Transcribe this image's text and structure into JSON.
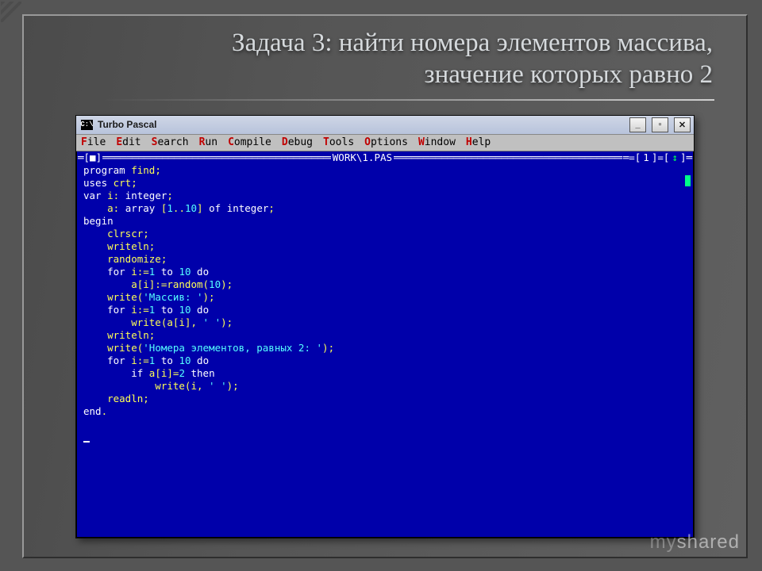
{
  "slide": {
    "title": "Задача 3: найти номера элементов массива, значение которых равно 2"
  },
  "window": {
    "icon_text": "C:\\",
    "title": "Turbo Pascal",
    "buttons": {
      "min": "_",
      "max": "▫",
      "close": "✕"
    }
  },
  "menubar": {
    "items": [
      {
        "hot": "F",
        "rest": "ile"
      },
      {
        "hot": "E",
        "rest": "dit"
      },
      {
        "hot": "S",
        "rest": "earch"
      },
      {
        "hot": "R",
        "rest": "un"
      },
      {
        "hot": "C",
        "rest": "ompile"
      },
      {
        "hot": "D",
        "rest": "ebug"
      },
      {
        "hot": "T",
        "rest": "ools"
      },
      {
        "hot": "O",
        "rest": "ptions"
      },
      {
        "hot": "W",
        "rest": "indow"
      },
      {
        "hot": "H",
        "rest": "elp"
      }
    ]
  },
  "editor": {
    "frame": {
      "filename": " WORK\\1.PAS ",
      "index": "1",
      "brackets_left": "═[■]",
      "brackets_right_num": "═=[",
      "arrow": "↕",
      "brackets_end": "]═"
    },
    "code": {
      "l01a": "program",
      "l01b": " find",
      "l01c": ";",
      "l02a": "uses",
      "l02b": " crt",
      "l02c": ";",
      "l03a": "var",
      "l03b": " i: ",
      "l03c": "integer",
      "l03d": ";",
      "l04a": "    a: ",
      "l04b": "array",
      "l04c": " [",
      "l04d": "1",
      "l04e": "..",
      "l04f": "10",
      "l04g": "] ",
      "l04h": "of",
      "l04i": " ",
      "l04j": "integer",
      "l04k": ";",
      "l05a": "begin",
      "l06a": "    clrscr;",
      "l07a": "    writeln;",
      "l08a": "    randomize;",
      "l09a": "    ",
      "l09b": "for",
      "l09c": " i:=",
      "l09d": "1",
      "l09e": " ",
      "l09f": "to",
      "l09g": " ",
      "l09h": "10",
      "l09i": " ",
      "l09j": "do",
      "l10a": "        a[i]:=random(",
      "l10b": "10",
      "l10c": ");",
      "l11a": "    write(",
      "l11b": "'Массив: '",
      "l11c": ");",
      "l12a": "    ",
      "l12b": "for",
      "l12c": " i:=",
      "l12d": "1",
      "l12e": " ",
      "l12f": "to",
      "l12g": " ",
      "l12h": "10",
      "l12i": " ",
      "l12j": "do",
      "l13a": "        write(a[i], ",
      "l13b": "' '",
      "l13c": ");",
      "l14a": "    writeln;",
      "l15a": "    write(",
      "l15b": "'Номера элементов, равных 2: '",
      "l15c": ");",
      "l16a": "    ",
      "l16b": "for",
      "l16c": " i:=",
      "l16d": "1",
      "l16e": " ",
      "l16f": "to",
      "l16g": " ",
      "l16h": "10",
      "l16i": " ",
      "l16j": "do",
      "l17a": "        ",
      "l17b": "if",
      "l17c": " a[i]=",
      "l17d": "2",
      "l17e": " ",
      "l17f": "then",
      "l18a": "            write(i, ",
      "l18b": "' '",
      "l18c": ");",
      "l19a": "    readln;",
      "l20a": "end",
      "l20b": "."
    }
  },
  "watermark": {
    "text": "myshared",
    "dim": "my"
  }
}
